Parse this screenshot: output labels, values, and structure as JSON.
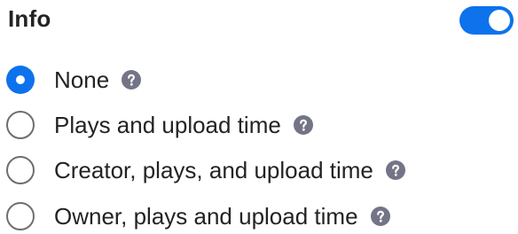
{
  "section": {
    "title": "Info",
    "toggle_on": true
  },
  "options": [
    {
      "label": "None",
      "selected": true,
      "icon": "help-icon"
    },
    {
      "label": "Plays and upload time",
      "selected": false,
      "icon": "help-icon"
    },
    {
      "label": "Creator, plays, and upload time",
      "selected": false,
      "icon": "help-icon"
    },
    {
      "label": "Owner, plays and upload time",
      "selected": false,
      "icon": "help-icon"
    }
  ],
  "colors": {
    "accent": "#0e72ed",
    "text": "#232323",
    "radio_border": "#6e6e72",
    "help_icon": "#747487"
  }
}
